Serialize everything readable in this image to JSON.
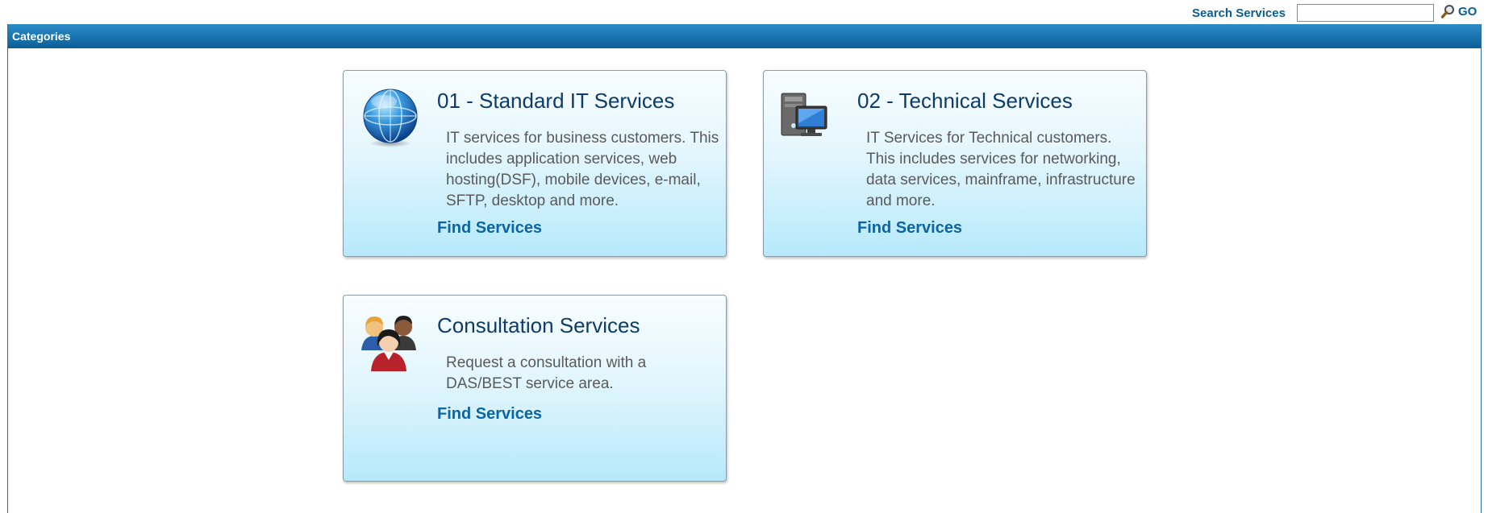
{
  "search": {
    "label": "Search Services",
    "value": "",
    "go_label": "GO"
  },
  "panel": {
    "title": "Categories"
  },
  "categories": [
    {
      "title": "01 - Standard IT Services",
      "description": "IT services for business customers. This includes application services, web hosting(DSF), mobile devices, e-mail, SFTP, desktop and more.",
      "link_label": "Find Services",
      "icon": "globe-icon"
    },
    {
      "title": "02 - Technical Services",
      "description": "IT Services for Technical customers. This includes services for networking, data services, mainframe, infrastructure and more.",
      "link_label": "Find Services",
      "icon": "computer-icon"
    },
    {
      "title": "Consultation Services",
      "description": "Request a consultation with a DAS/BEST service area.",
      "link_label": "Find Services",
      "icon": "people-icon"
    }
  ],
  "colors": {
    "header_blue": "#1d78b4",
    "link_blue": "#0b64a3",
    "title_navy": "#0c3c67",
    "card_gradient_bottom": "#b6e9fb"
  }
}
